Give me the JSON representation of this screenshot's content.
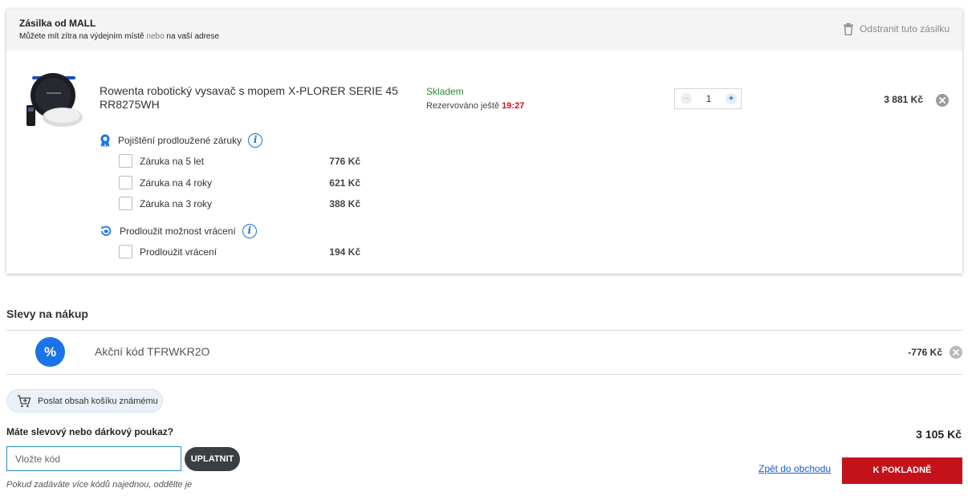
{
  "shipment": {
    "title": "Zásilka od MALL",
    "subtitle_part1": "Můžete mít zítra na výdejním místě",
    "subtitle_conj": " nebo ",
    "subtitle_part2": "na vaší adrese",
    "remove_label": "Odstranit tuto zásilku",
    "remove_icon": "trash-icon"
  },
  "product": {
    "name": "Rowenta robotický vysavač s mopem X-PLORER SERIE 45 RR8275WH",
    "stock_status": "Skladem",
    "reserved_label": "Rezervováno ještě ",
    "reserved_time": "19:27",
    "quantity": "1",
    "minus_symbol": "−",
    "plus_symbol": "+",
    "price": "3 881 Kč"
  },
  "warranty": {
    "label": "Pojištění prodloužené záruky",
    "info_symbol": "i",
    "options": [
      {
        "label": "Záruka na 5 let",
        "price": "776 Kč"
      },
      {
        "label": "Záruka na 4 roky",
        "price": "621 Kč"
      },
      {
        "label": "Záruka na 3 roky",
        "price": "388 Kč"
      }
    ]
  },
  "returns": {
    "label": "Prodloužit možnost vrácení",
    "info_symbol": "i",
    "options": [
      {
        "label": "Prodloužit vrácení",
        "price": "194 Kč"
      }
    ]
  },
  "discounts": {
    "heading": "Slevy na nákup",
    "icon_symbol": "%",
    "code_label": "Akční kód TFRWKR2O",
    "amount": "-776 Kč"
  },
  "share": {
    "label": "Poslat obsah košíku známému"
  },
  "voucher": {
    "question": "Máte slevový nebo dárkový poukaz?",
    "placeholder": "Vložte kód",
    "apply_label": "UPLATNIT",
    "hint": "Pokud zadáváte více kódů najednou, oddělte je"
  },
  "summary": {
    "total": "3 105 Kč",
    "back_label": "Zpět do obchodu",
    "checkout_label": "K POKLADNĚ"
  },
  "colors": {
    "accent_blue": "#1a73e8",
    "in_stock_green": "#2a8a35",
    "checkout_red": "#c4121a",
    "time_red": "#c0161c"
  }
}
